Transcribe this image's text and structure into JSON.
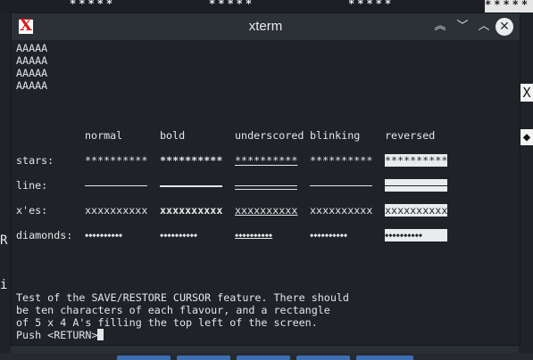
{
  "background": {
    "stars_top": [
      "*****",
      "*****",
      "*****"
    ],
    "stars_corner": "*****",
    "right_glyphs": [
      "X",
      "◆"
    ],
    "left_glyphs": [
      "R",
      "i"
    ]
  },
  "window": {
    "title": "xterm",
    "icon_letter": "X",
    "controls": [
      "⌃⌃",
      "⌄",
      "⌃",
      "✕"
    ]
  },
  "terminal": {
    "a_rows": [
      "AAAAA",
      "AAAAA",
      "AAAAA",
      "AAAAA"
    ],
    "headers": [
      "normal",
      "bold",
      "underscored",
      "blinking",
      "reversed"
    ],
    "rows": [
      {
        "label": "stars:",
        "sample": "**********"
      },
      {
        "label": "line:",
        "sample": ""
      },
      {
        "label": "x'es:",
        "sample": "xxxxxxxxxx"
      },
      {
        "label": "diamonds:",
        "sample": "◆◆◆◆◆◆◆◆◆◆"
      }
    ],
    "message": [
      "Test of the SAVE/RESTORE CURSOR feature. There should",
      "be ten characters of each flavour, and a rectangle",
      "of 5 x 4 A's filling the top left of the screen."
    ],
    "prompt": "Push <RETURN>"
  },
  "colors": {
    "terminal_bg": "#1f2328",
    "text": "#e4e6e8",
    "title_bar": "#2c3137",
    "icon_red": "#d6201c"
  }
}
